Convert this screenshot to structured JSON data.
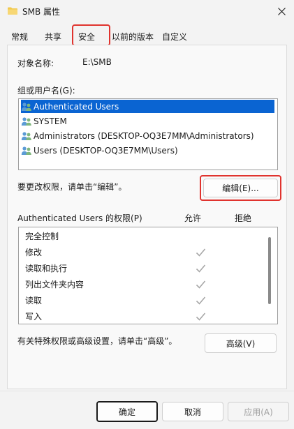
{
  "window": {
    "title": "SMB 属性",
    "icon": "folder-icon",
    "close_icon": "close-icon"
  },
  "tabs": [
    {
      "label": "常规",
      "active": false
    },
    {
      "label": "共享",
      "active": false
    },
    {
      "label": "安全",
      "active": true
    },
    {
      "label": "以前的版本",
      "active": false
    },
    {
      "label": "自定义",
      "active": false
    }
  ],
  "object": {
    "label": "对象名称:",
    "value": "E:\\SMB"
  },
  "groups": {
    "label": "组或用户名(G):",
    "items": [
      {
        "label": "Authenticated Users",
        "selected": true
      },
      {
        "label": "SYSTEM",
        "selected": false
      },
      {
        "label": "Administrators (DESKTOP-OQ3E7MM\\Administrators)",
        "selected": false
      },
      {
        "label": "Users (DESKTOP-OQ3E7MM\\Users)",
        "selected": false
      }
    ]
  },
  "edit": {
    "hint": "要更改权限，请单击“编辑”。",
    "button": "编辑(E)..."
  },
  "permissions": {
    "header": "Authenticated Users 的权限(P)",
    "allow_label": "允许",
    "deny_label": "拒绝",
    "rows": [
      {
        "label": "完全控制",
        "allow": false,
        "deny": false
      },
      {
        "label": "修改",
        "allow": true,
        "deny": false
      },
      {
        "label": "读取和执行",
        "allow": true,
        "deny": false
      },
      {
        "label": "列出文件夹内容",
        "allow": true,
        "deny": false
      },
      {
        "label": "读取",
        "allow": true,
        "deny": false
      },
      {
        "label": "写入",
        "allow": true,
        "deny": false
      }
    ]
  },
  "advanced": {
    "hint": "有关特殊权限或高级设置，请单击“高级”。",
    "button": "高级(V)"
  },
  "footer": {
    "ok": "确定",
    "cancel": "取消",
    "apply": "应用(A)"
  },
  "colors": {
    "highlight": "#e0332e",
    "selection": "#0a64d2",
    "check": "#a7a7a7"
  }
}
